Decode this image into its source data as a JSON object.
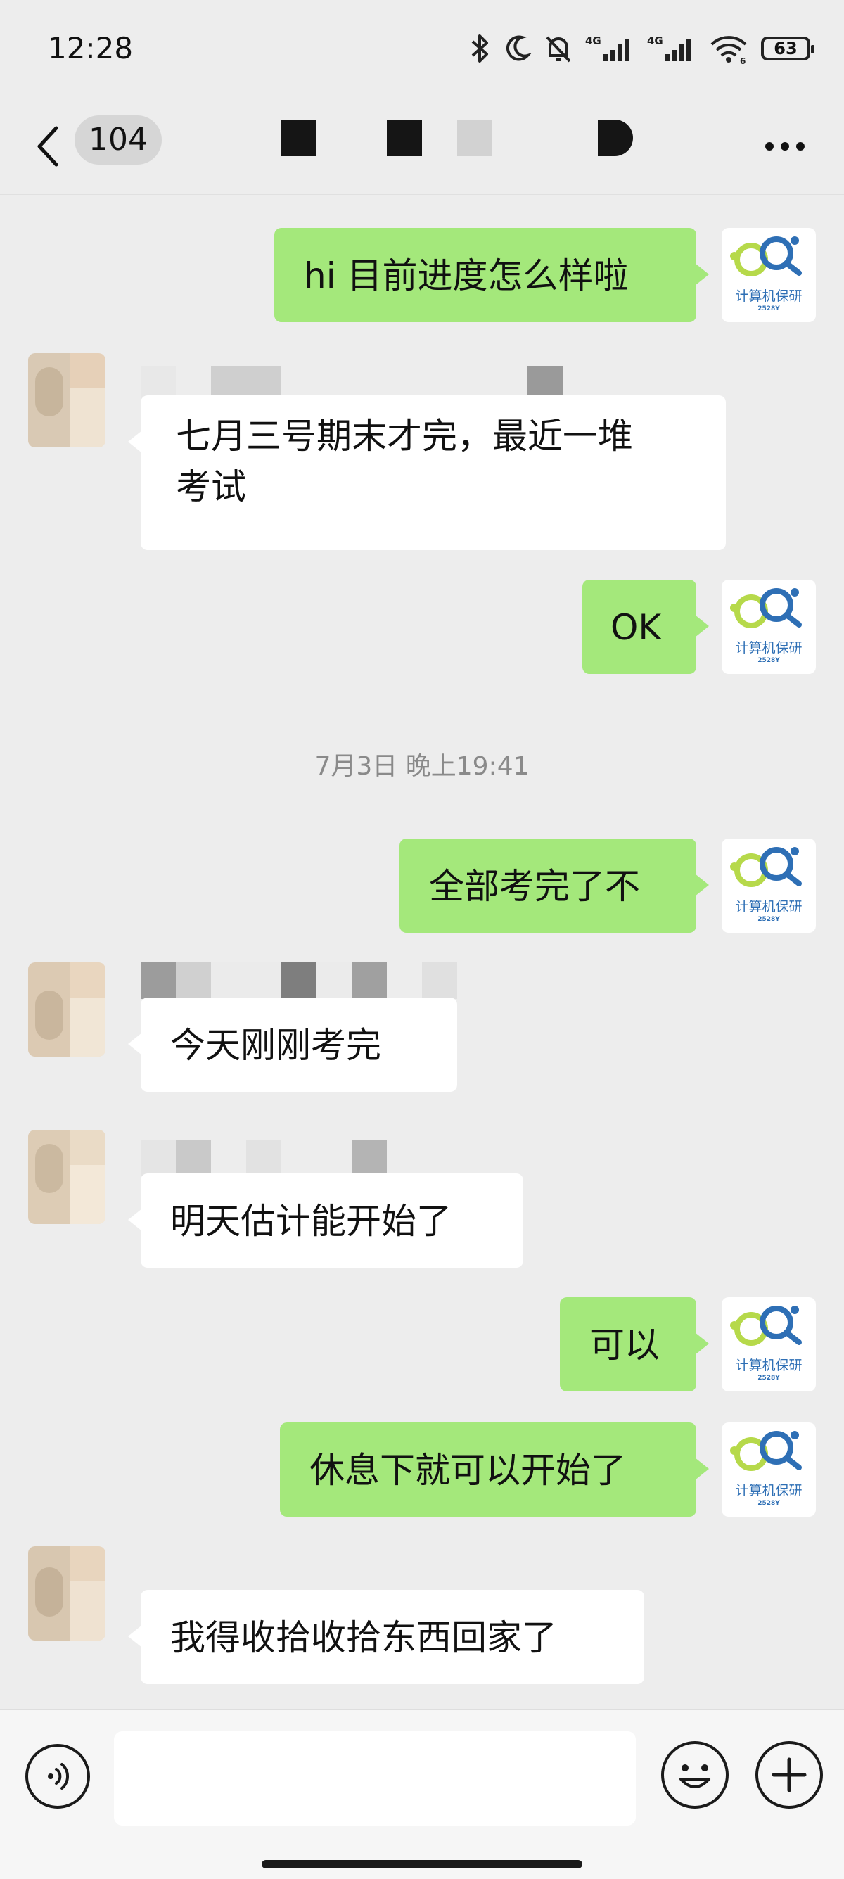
{
  "status_bar": {
    "time": "12:28",
    "network_1": "4G",
    "network_2": "4G",
    "wifi_sub": "6",
    "battery": "63"
  },
  "header": {
    "unread_count": "104"
  },
  "messages": [
    {
      "from": "me",
      "text": "hi 目前进度怎么样啦"
    },
    {
      "from": "them",
      "text_line1": "七月三号期末才完，最近一堆",
      "text_line2": "考试"
    },
    {
      "from": "me",
      "text": "OK"
    },
    {
      "from": "me",
      "text": "全部考完了不"
    },
    {
      "from": "them",
      "text": "今天刚刚考完"
    },
    {
      "from": "them",
      "text": "明天估计能开始了"
    },
    {
      "from": "me",
      "text": "可以"
    },
    {
      "from": "me",
      "text": "休息下就可以开始了"
    },
    {
      "from": "them",
      "text": "我得收拾收拾东西回家了"
    }
  ],
  "timestamp": "7月3日 晚上19:41",
  "my_avatar": {
    "logo_text": "计算机保研",
    "logo_year": "2528Y",
    "colors": {
      "green": "#b6d94a",
      "blue": "#2e6fb5"
    }
  },
  "input": {
    "placeholder": ""
  },
  "colors": {
    "background": "#ededed",
    "my_bubble": "#a4e87b",
    "their_bubble": "#ffffff"
  }
}
